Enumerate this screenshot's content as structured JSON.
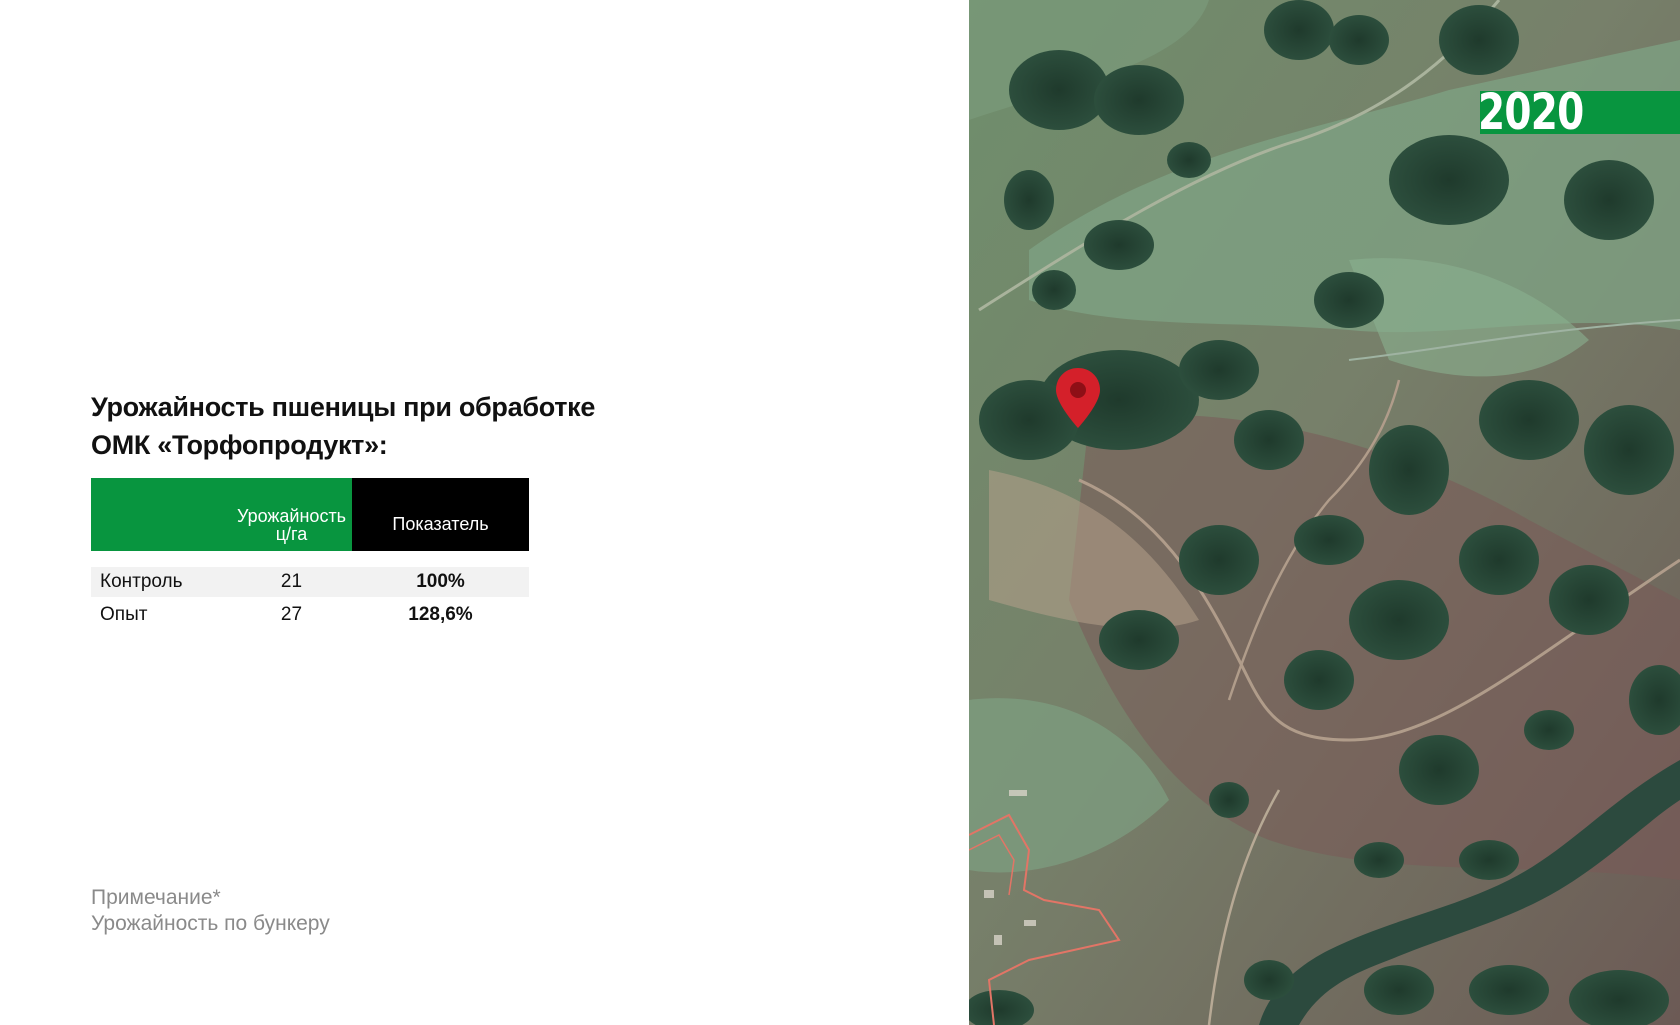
{
  "title": {
    "line1": "Урожайность пшеницы при обработке",
    "line2": "ОМК «Торфопродукт»:"
  },
  "table": {
    "header_yield_line1": "Урожайность",
    "header_yield_line2": "ц/га",
    "header_indicator": "Показатель",
    "rows": [
      {
        "name": "Контроль",
        "yield": "21",
        "indicator": "100%"
      },
      {
        "name": "Опыт",
        "yield": "27",
        "indicator": "128,6%"
      }
    ]
  },
  "note": {
    "line1": "Примечание*",
    "line2": "Урожайность по бункеру"
  },
  "map": {
    "year": "2020",
    "marker_icon": "map-pin-icon",
    "accent_color": "#08953f",
    "marker_color": "#d4202a"
  }
}
